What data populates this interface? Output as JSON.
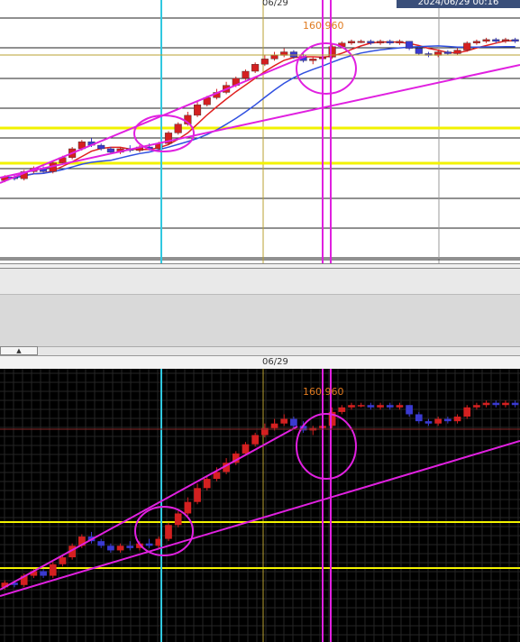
{
  "top_panel": {
    "date_label": "06/29",
    "timestamp": "2024/06/29 00:16",
    "price_label": "160.960"
  },
  "bottom_panel": {
    "date_label": "06/29",
    "price_label": "160.960"
  },
  "colors": {
    "bull": "#d42020",
    "bear": "#3a3ad0",
    "magenta": "#e020e0",
    "yellow": "#f2f200",
    "cyan": "#30c8e0",
    "olive": "#b8a030",
    "ma_blue": "#3050e0",
    "ma_red": "#e02020"
  },
  "chart_data": {
    "type": "candlestick",
    "x_marker": "06/29",
    "highlight_price": 160.96,
    "candles": [
      {
        "o": 1,
        "c": 3,
        "h": 4,
        "l": 0
      },
      {
        "o": 3,
        "c": 2,
        "h": 4,
        "l": 1
      },
      {
        "o": 2,
        "c": 6,
        "h": 7,
        "l": 1
      },
      {
        "o": 6,
        "c": 8,
        "h": 9,
        "l": 5
      },
      {
        "o": 8,
        "c": 6,
        "h": 9,
        "l": 5
      },
      {
        "o": 6,
        "c": 11,
        "h": 12,
        "l": 5
      },
      {
        "o": 11,
        "c": 14,
        "h": 15,
        "l": 10
      },
      {
        "o": 14,
        "c": 19,
        "h": 20,
        "l": 13
      },
      {
        "o": 19,
        "c": 23,
        "h": 24,
        "l": 18
      },
      {
        "o": 23,
        "c": 21,
        "h": 25,
        "l": 20
      },
      {
        "o": 21,
        "c": 19,
        "h": 22,
        "l": 18
      },
      {
        "o": 19,
        "c": 17,
        "h": 20,
        "l": 16
      },
      {
        "o": 17,
        "c": 19,
        "h": 20,
        "l": 16
      },
      {
        "o": 19,
        "c": 18,
        "h": 21,
        "l": 17
      },
      {
        "o": 18,
        "c": 20,
        "h": 21,
        "l": 17
      },
      {
        "o": 20,
        "c": 19,
        "h": 22,
        "l": 18
      },
      {
        "o": 19,
        "c": 22,
        "h": 23,
        "l": 18
      },
      {
        "o": 22,
        "c": 28,
        "h": 29,
        "l": 21
      },
      {
        "o": 28,
        "c": 33,
        "h": 34,
        "l": 27
      },
      {
        "o": 33,
        "c": 38,
        "h": 40,
        "l": 32
      },
      {
        "o": 38,
        "c": 44,
        "h": 46,
        "l": 37
      },
      {
        "o": 44,
        "c": 48,
        "h": 49,
        "l": 43
      },
      {
        "o": 48,
        "c": 51,
        "h": 53,
        "l": 47
      },
      {
        "o": 51,
        "c": 55,
        "h": 57,
        "l": 50
      },
      {
        "o": 55,
        "c": 59,
        "h": 60,
        "l": 54
      },
      {
        "o": 59,
        "c": 63,
        "h": 64,
        "l": 58
      },
      {
        "o": 63,
        "c": 67,
        "h": 68,
        "l": 62
      },
      {
        "o": 67,
        "c": 70,
        "h": 72,
        "l": 66
      },
      {
        "o": 70,
        "c": 72,
        "h": 74,
        "l": 69
      },
      {
        "o": 72,
        "c": 74,
        "h": 76,
        "l": 71
      },
      {
        "o": 74,
        "c": 71,
        "h": 75,
        "l": 70
      },
      {
        "o": 71,
        "c": 69,
        "h": 73,
        "l": 68
      },
      {
        "o": 69,
        "c": 70,
        "h": 71,
        "l": 67
      },
      {
        "o": 70,
        "c": 71,
        "h": 72,
        "l": 69
      },
      {
        "o": 71,
        "c": 77,
        "h": 79,
        "l": 70
      },
      {
        "o": 77,
        "c": 79,
        "h": 80,
        "l": 76
      },
      {
        "o": 79,
        "c": 80,
        "h": 81,
        "l": 78
      },
      {
        "o": 80,
        "c": 80,
        "h": 81,
        "l": 79
      },
      {
        "o": 80,
        "c": 79,
        "h": 81,
        "l": 78
      },
      {
        "o": 79,
        "c": 80,
        "h": 81,
        "l": 78
      },
      {
        "o": 80,
        "c": 79,
        "h": 81,
        "l": 78
      },
      {
        "o": 79,
        "c": 80,
        "h": 81,
        "l": 78
      },
      {
        "o": 80,
        "c": 76,
        "h": 80,
        "l": 75
      },
      {
        "o": 76,
        "c": 73,
        "h": 77,
        "l": 72
      },
      {
        "o": 73,
        "c": 72,
        "h": 74,
        "l": 71
      },
      {
        "o": 72,
        "c": 74,
        "h": 75,
        "l": 71
      },
      {
        "o": 74,
        "c": 73,
        "h": 75,
        "l": 72
      },
      {
        "o": 73,
        "c": 75,
        "h": 76,
        "l": 72
      },
      {
        "o": 75,
        "c": 79,
        "h": 80,
        "l": 74
      },
      {
        "o": 79,
        "c": 80,
        "h": 81,
        "l": 78
      },
      {
        "o": 80,
        "c": 81,
        "h": 82,
        "l": 79
      },
      {
        "o": 81,
        "c": 80,
        "h": 82,
        "l": 79
      },
      {
        "o": 80,
        "c": 81,
        "h": 82,
        "l": 79
      },
      {
        "o": 81,
        "c": 80,
        "h": 82,
        "l": 79
      }
    ]
  }
}
